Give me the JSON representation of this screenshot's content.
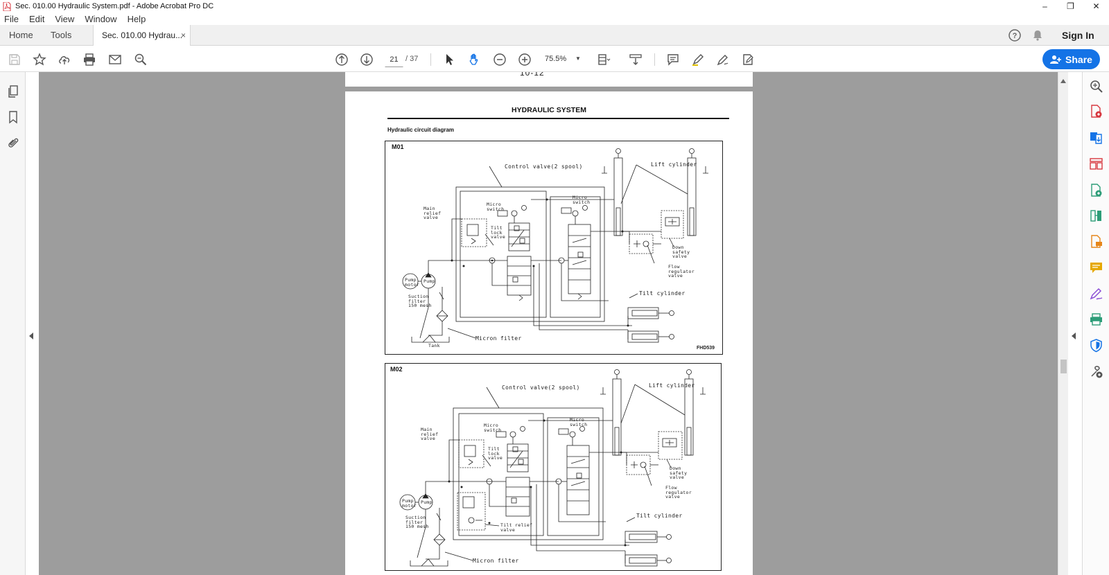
{
  "window": {
    "title": "Sec. 010.00 Hydraulic System.pdf - Adobe Acrobat Pro DC",
    "minimize": "–",
    "restore": "❐",
    "close": "✕"
  },
  "menu": [
    "File",
    "Edit",
    "View",
    "Window",
    "Help"
  ],
  "tabs": {
    "home": "Home",
    "tools": "Tools",
    "document": "Sec. 010.00 Hydrau...",
    "close": "×"
  },
  "account": {
    "sign_in": "Sign In"
  },
  "toolbar": {
    "page_current": "21",
    "page_separator": "/ 37",
    "zoom": "75.5%",
    "share_label": "Share"
  },
  "document": {
    "prev_page_fragment": "10-12",
    "title": "HYDRAULIC SYSTEM",
    "subtitle": "Hydraulic circuit diagram",
    "diagrams": [
      {
        "tag": "M01",
        "code": "FHD539",
        "labels": {
          "control_valve": "Control valve(2 spool)",
          "lift_cylinder": "Lift cylinder",
          "main_relief": "Main\nrelief\nvalve",
          "micro_switch_1": "Micro\nswitch",
          "micro_switch_2": "Micro\nswitch",
          "tilt_lock": "Tilt\nlock\nvalve",
          "down_safety": "Down\nsafety\nvalve",
          "flow_regulator": "Flow\nregulator\nvalve",
          "pump_motor": "Pump\nmotor",
          "pump": "Pump",
          "suction_filter": "Suction\nfilter\n150 mesh",
          "tilt_cylinder": "Tilt cylinder",
          "micron_filter": "Micron filter",
          "tank": "Tank"
        }
      },
      {
        "tag": "M02",
        "labels": {
          "control_valve": "Control valve(2 spool)",
          "lift_cylinder": "Lift cylinder",
          "main_relief": "Main\nrelief\nvalve",
          "micro_switch_1": "Micro\nswitch",
          "micro_switch_2": "Micro\nswitch",
          "tilt_lock": "Tilt\nlock\nvalve",
          "tilt_relief": "Tilt relief\nvalve",
          "down_safety": "Down\nsafety\nvalve",
          "flow_regulator": "Flow\nregulator\nvalve",
          "pump_motor": "Pump\nmotor",
          "pump": "Pump",
          "suction_filter": "Suction\nfilter\n150 mesh",
          "tilt_cylinder": "Tilt cylinder",
          "micron_filter": "Micron filter"
        }
      }
    ]
  },
  "colors": {
    "share_button": "#1473e6",
    "doc_background": "#9d9d9d",
    "accent_red": "#d7373f",
    "accent_purple": "#8b4fd6",
    "accent_green": "#2d9d78",
    "accent_orange": "#e68619",
    "accent_blue": "#1473e6"
  },
  "icons": {
    "left": [
      "pages-icon",
      "bookmark-icon",
      "attachment-icon"
    ],
    "right": [
      "zoom-tool-icon",
      "export-pdf-icon",
      "create-pdf-icon",
      "organize-pages-icon",
      "edit-pdf-icon",
      "combine-files-icon",
      "send-for-comments-icon",
      "comment-icon",
      "fill-sign-icon",
      "print-production-icon",
      "protect-icon",
      "more-tools-icon"
    ]
  }
}
